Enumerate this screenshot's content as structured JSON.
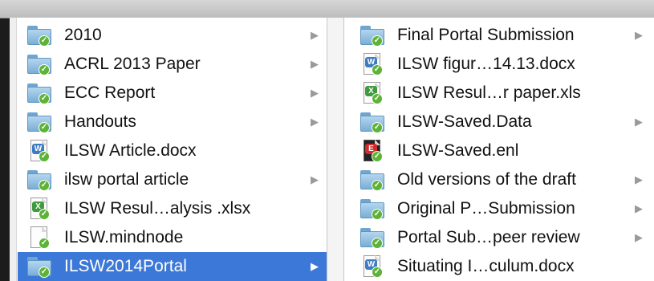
{
  "columns": [
    {
      "items": [
        {
          "label": "2010",
          "kind": "folder",
          "has_children": true
        },
        {
          "label": "ACRL 2013 Paper",
          "kind": "folder",
          "has_children": true
        },
        {
          "label": "ECC Report",
          "kind": "folder",
          "has_children": true
        },
        {
          "label": "Handouts",
          "kind": "folder",
          "has_children": true
        },
        {
          "label": "ILSW Article.docx",
          "kind": "docx",
          "has_children": false
        },
        {
          "label": "ilsw portal article",
          "kind": "folder",
          "has_children": true
        },
        {
          "label": "ILSW Resul…alysis .xlsx",
          "kind": "xls",
          "has_children": false
        },
        {
          "label": "ILSW.mindnode",
          "kind": "plain",
          "has_children": false
        },
        {
          "label": "ILSW2014Portal",
          "kind": "folder",
          "has_children": true,
          "selected": true
        }
      ]
    },
    {
      "items": [
        {
          "label": "Final Portal Submission",
          "kind": "folder",
          "has_children": true
        },
        {
          "label": "ILSW figur…14.13.docx",
          "kind": "docx",
          "has_children": false
        },
        {
          "label": "ILSW Resul…r paper.xls",
          "kind": "xls",
          "has_children": false
        },
        {
          "label": "ILSW-Saved.Data",
          "kind": "folder",
          "has_children": true
        },
        {
          "label": "ILSW-Saved.enl",
          "kind": "enl",
          "has_children": false
        },
        {
          "label": "Old versions of the draft",
          "kind": "folder",
          "has_children": true
        },
        {
          "label": "Original P…Submission",
          "kind": "folder",
          "has_children": true
        },
        {
          "label": "Portal Sub…peer review",
          "kind": "folder",
          "has_children": true
        },
        {
          "label": "Situating I…culum.docx",
          "kind": "docx",
          "has_children": false
        }
      ]
    }
  ],
  "colors": {
    "selection": "#3c78d8",
    "sync_badge": "#5cb335"
  },
  "icons": {
    "folder": "folder-icon",
    "docx": "word-document-icon",
    "xls": "excel-spreadsheet-icon",
    "enl": "endnote-library-icon",
    "plain": "generic-document-icon",
    "arrow": "disclosure-arrow-icon"
  }
}
